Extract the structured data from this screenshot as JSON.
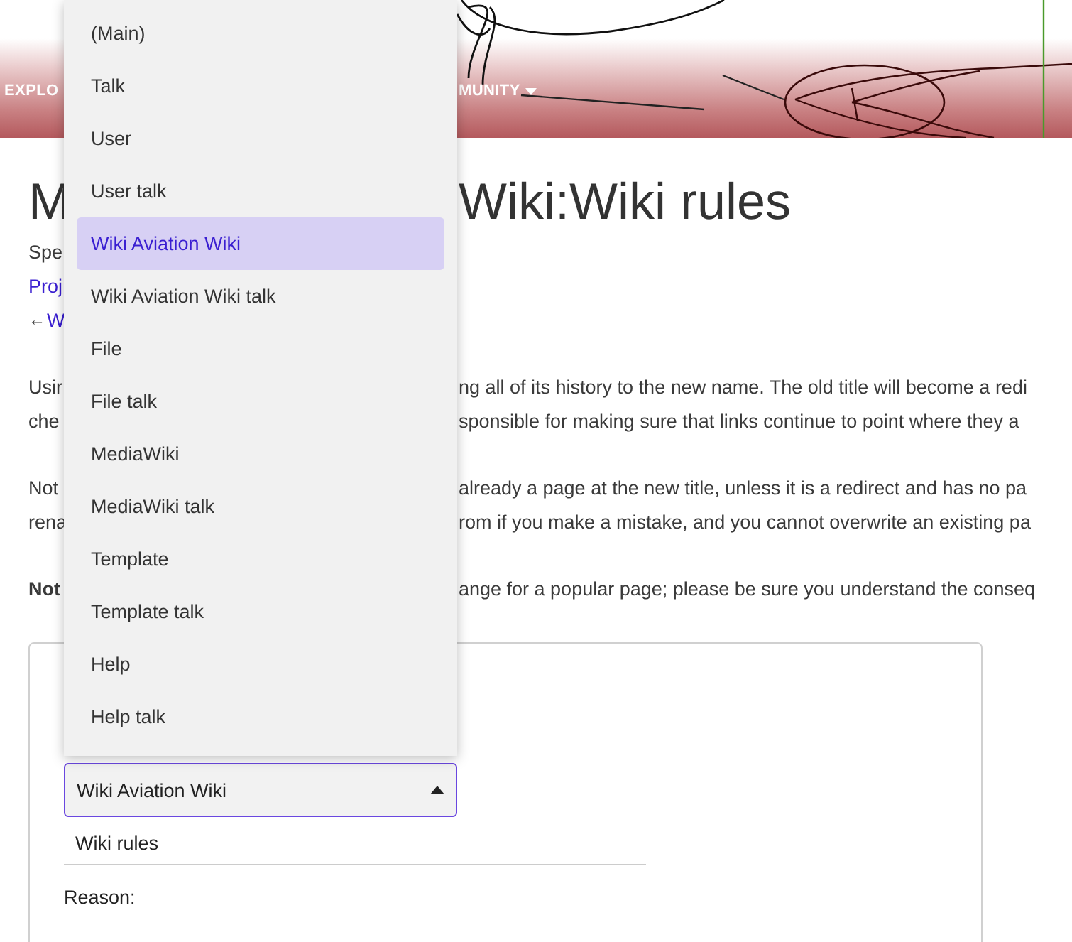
{
  "header": {
    "nav": [
      {
        "label": "EXPLO",
        "has_menu": false
      },
      {
        "label": "MUNITY",
        "has_menu": true
      }
    ]
  },
  "title": {
    "left": "M",
    "right": "Wiki:Wiki rules"
  },
  "subtitle": "Spe",
  "breadcrumb": "Proj",
  "back_link": {
    "arrow": "←",
    "label": "W"
  },
  "paragraphs": [
    {
      "lines": [
        {
          "left": "Usir",
          "right": "ng all of its history to the new name. The old title will become a redi"
        },
        {
          "left": "che",
          "right": "sponsible for making sure that links continue to point where they a"
        }
      ]
    },
    {
      "lines": [
        {
          "left": "Not",
          "right": "already a page at the new title, unless it is a redirect and has no pa"
        },
        {
          "left": "rena",
          "right": "rom if you make a mistake, and you cannot overwrite an existing pa"
        }
      ]
    },
    {
      "lines": [
        {
          "left": "**Not**",
          "right": "ange for a popular page; please be sure you understand the conseq"
        }
      ]
    }
  ],
  "namespace_select": {
    "value": "Wiki Aviation Wiki",
    "expanded": true,
    "options": [
      {
        "label": "(Main)",
        "selected": false
      },
      {
        "label": "Talk",
        "selected": false
      },
      {
        "label": "User",
        "selected": false
      },
      {
        "label": "User talk",
        "selected": false
      },
      {
        "label": "Wiki Aviation Wiki",
        "selected": true
      },
      {
        "label": "Wiki Aviation Wiki talk",
        "selected": false
      },
      {
        "label": "File",
        "selected": false
      },
      {
        "label": "File talk",
        "selected": false
      },
      {
        "label": "MediaWiki",
        "selected": false
      },
      {
        "label": "MediaWiki talk",
        "selected": false
      },
      {
        "label": "Template",
        "selected": false
      },
      {
        "label": "Template talk",
        "selected": false
      },
      {
        "label": "Help",
        "selected": false
      },
      {
        "label": "Help talk",
        "selected": false
      }
    ]
  },
  "target_field": {
    "value": "Wiki rules"
  },
  "reason_label": "Reason:"
}
